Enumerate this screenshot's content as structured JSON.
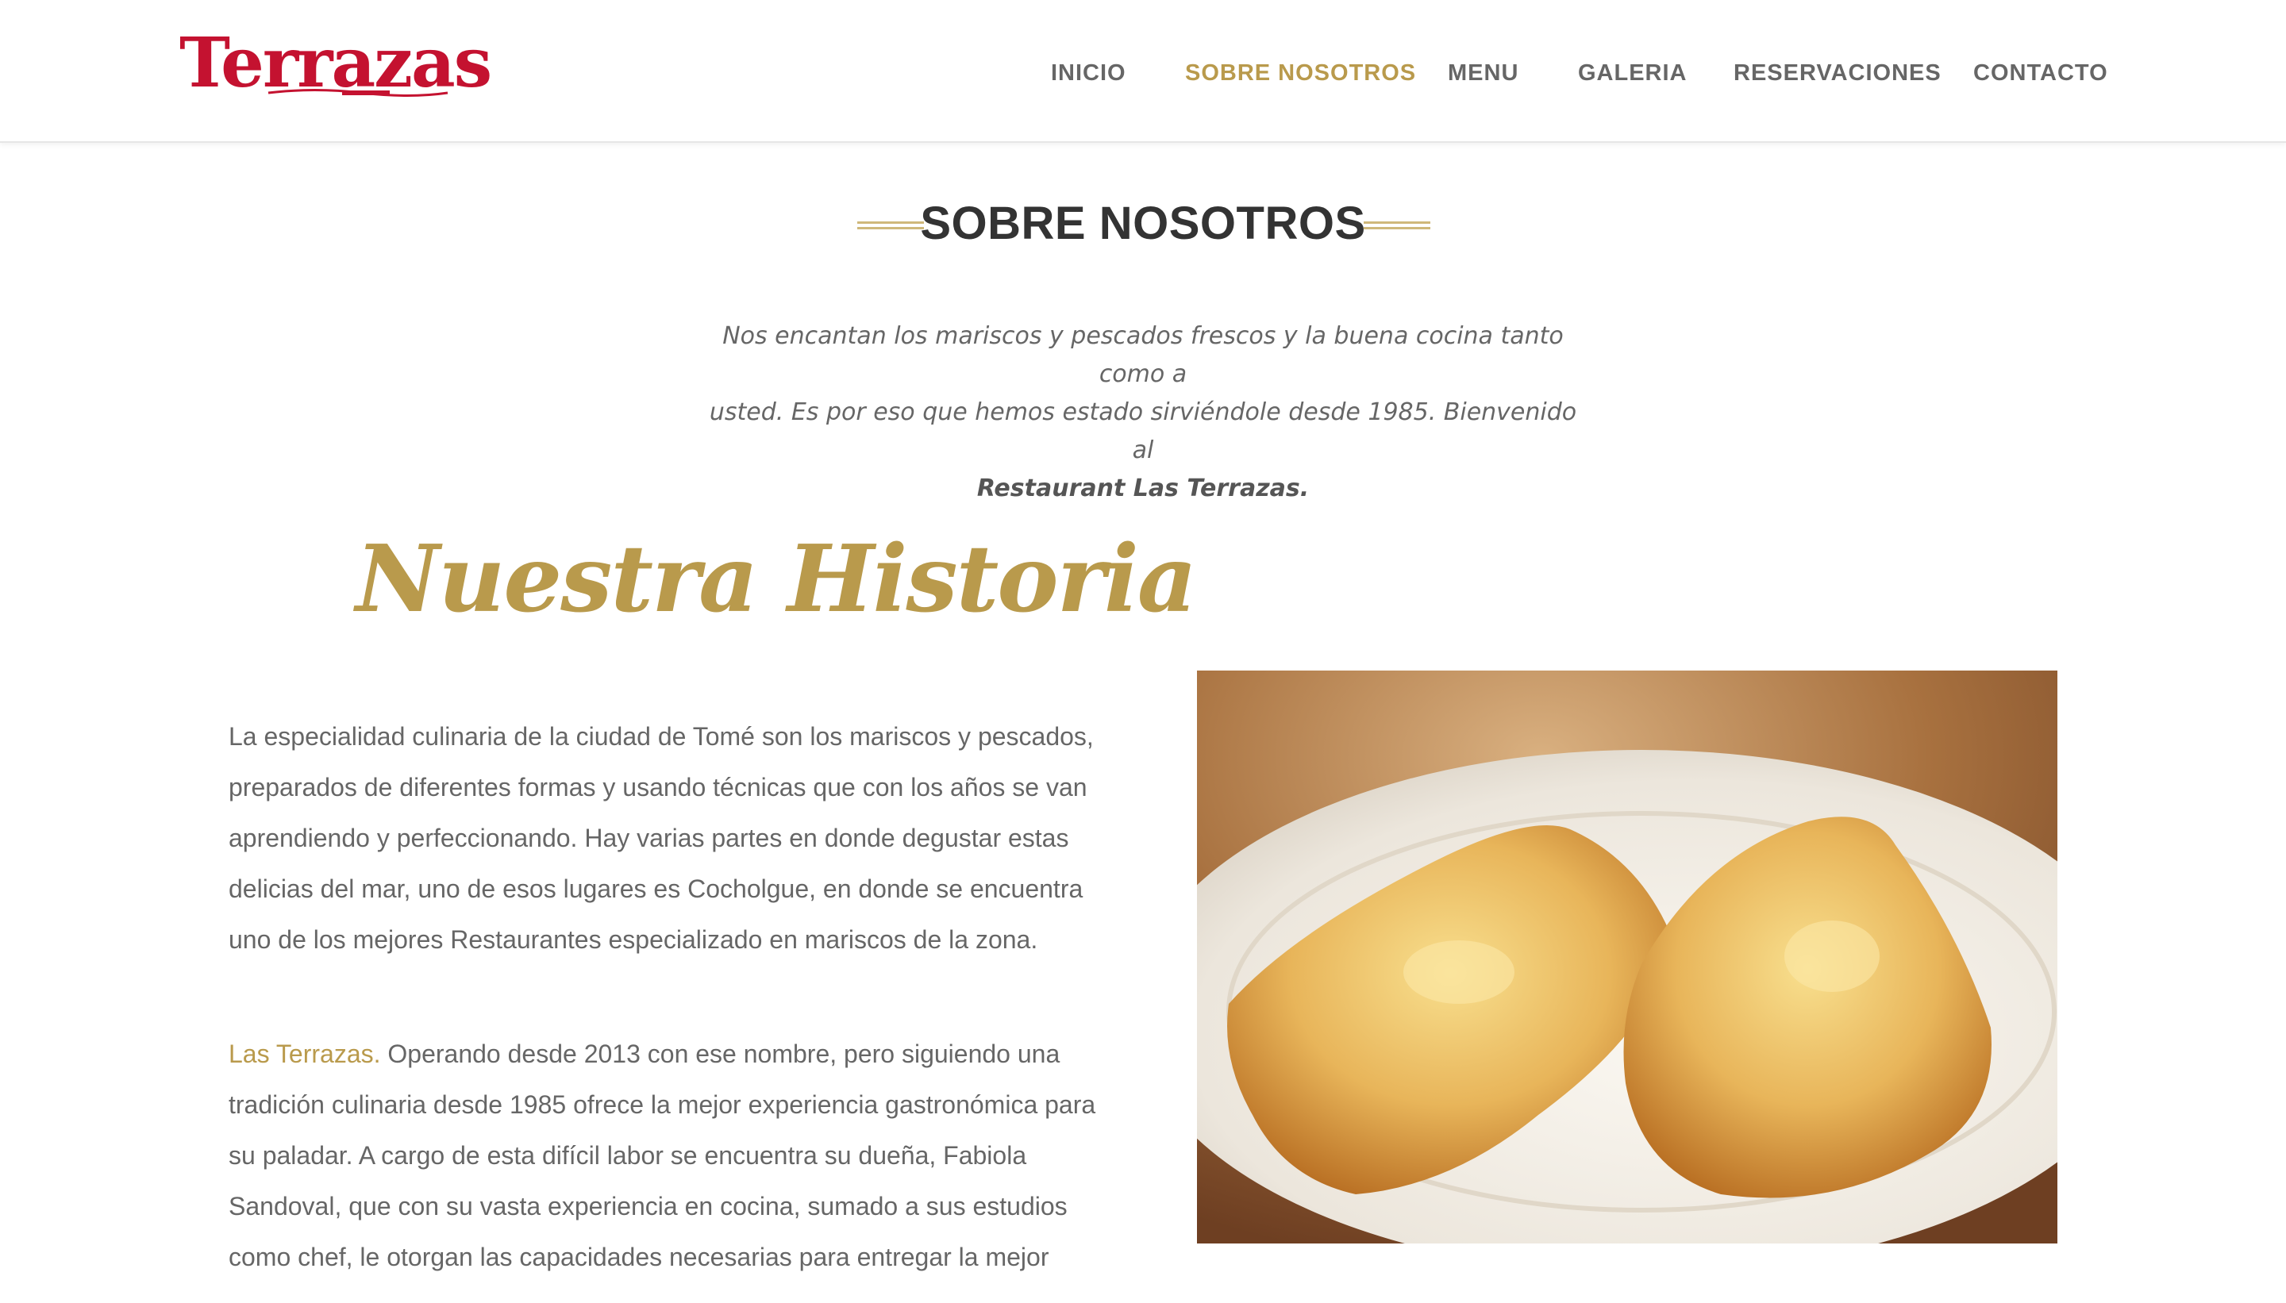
{
  "header": {
    "logo_text": "Terrazas",
    "nav": [
      {
        "label": "INICIO",
        "active": false
      },
      {
        "label": "SOBRE NOSOTROS",
        "active": true
      },
      {
        "label": "MENU",
        "active": false
      },
      {
        "label": "GALERIA",
        "active": false
      },
      {
        "label": "RESERVACIONES",
        "active": false
      },
      {
        "label": "CONTACTO",
        "active": false
      }
    ]
  },
  "section": {
    "title": "SOBRE NOSOTROS",
    "intro_1": "Nos encantan los mariscos y pescados frescos y la buena cocina tanto como a",
    "intro_2": "usted. Es por eso que hemos estado sirviéndole desde 1985. Bienvenido al",
    "intro_bold": "Restaurant Las Terrazas."
  },
  "history": {
    "heading": "Nuestra Historia",
    "para1": "La especialidad culinaria de la ciudad de Tomé son los mariscos y pescados, preparados de diferentes formas y usando técnicas que con los años se van aprendiendo y perfeccionando. Hay varias partes en donde degustar estas delicias del mar, uno de esos lugares es Cocholgue, en donde se encuentra uno de los mejores Restaurantes especializado en mariscos de la zona.",
    "para2_highlight": "Las Terrazas.",
    "para2_rest": " Operando desde 2013 con ese nombre, pero siguiendo una tradición culinaria desde 1985 ofrece la mejor experiencia gastronómica para su paladar. A cargo de esta difícil labor se encuentra su dueña, Fabiola Sandoval, que con su vasta experiencia en cocina, sumado a sus estudios como chef, le otorgan las capacidades necesarias para entregar la mejor"
  },
  "colors": {
    "brand_red": "#c41230",
    "accent_gold": "#b99a4c",
    "text_gray": "#666666"
  }
}
